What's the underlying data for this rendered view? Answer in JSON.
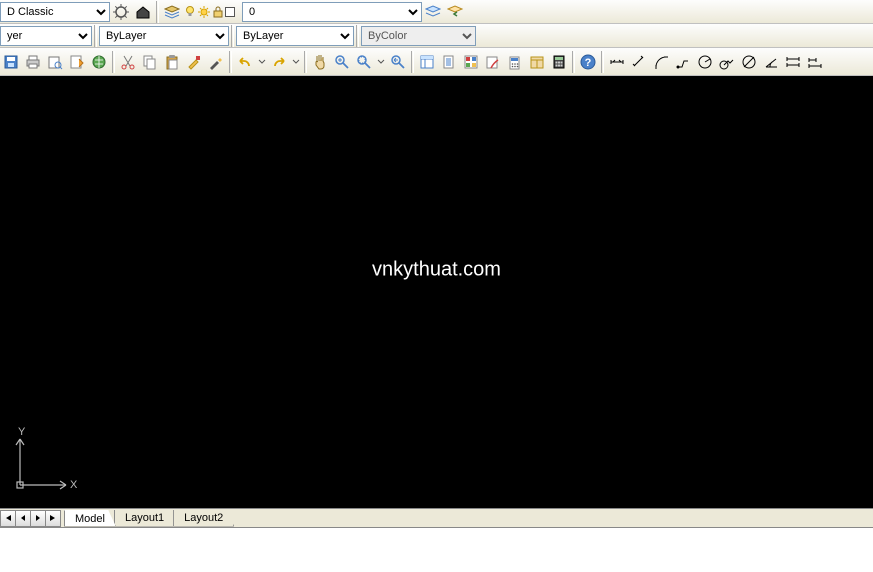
{
  "row1": {
    "workspace": "D Classic",
    "layer_current": "0",
    "layer_icons": [
      "bulb-on",
      "sun",
      "unlock",
      "color-white"
    ]
  },
  "row2": {
    "color_label": "yer",
    "linetype": "ByLayer",
    "lineweight": "ByLayer",
    "plotstyle": "ByColor"
  },
  "watermark": "vnkythuat.com",
  "ucs": {
    "y": "Y",
    "x": "X"
  },
  "tabs": {
    "model": "Model",
    "layout1": "Layout1",
    "layout2": "Layout2"
  },
  "cmd_prompt": " "
}
